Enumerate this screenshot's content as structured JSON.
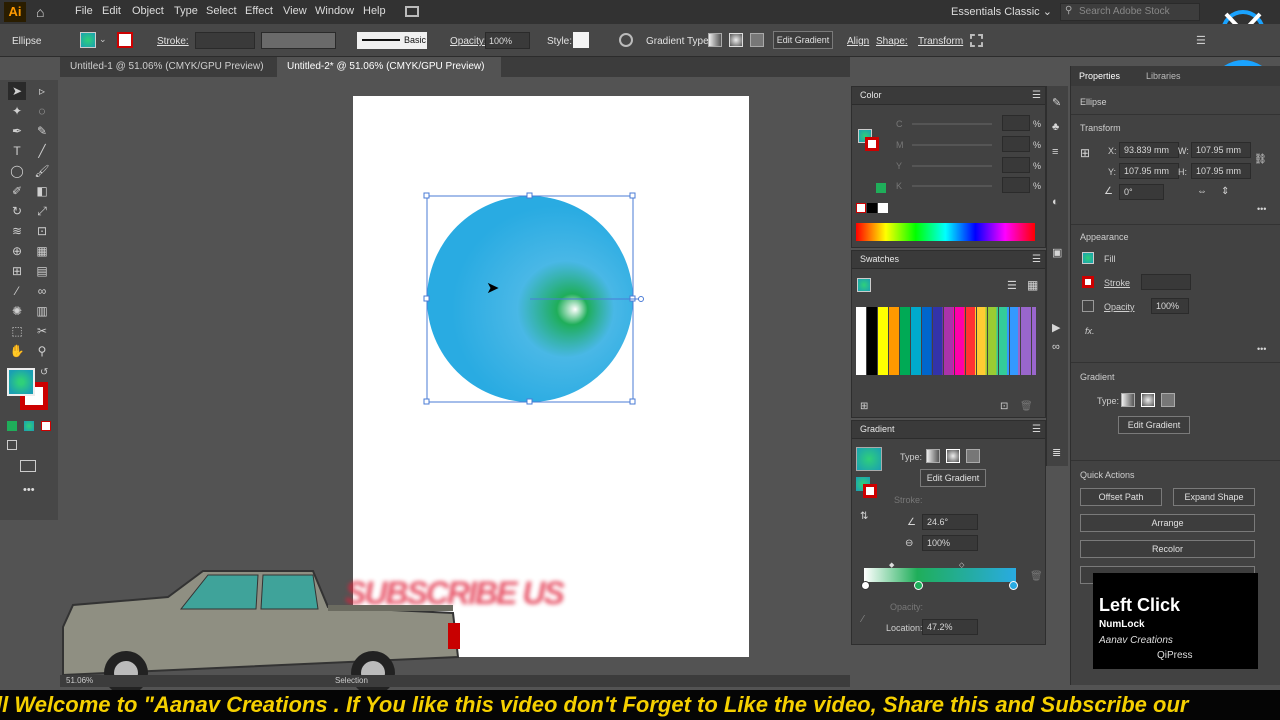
{
  "app": {
    "logo": "Ai",
    "workspace": "Essentials Classic",
    "search_placeholder": "Search Adobe Stock"
  },
  "menu": [
    "File",
    "Edit",
    "Object",
    "Type",
    "Select",
    "Effect",
    "View",
    "Window",
    "Help"
  ],
  "control": {
    "selection": "Ellipse",
    "stroke_label": "Stroke:",
    "brush": "Basic",
    "opacity_label": "Opacity:",
    "opacity": "100%",
    "style_label": "Style:",
    "gradient_type_label": "Gradient Type:",
    "edit_gradient": "Edit Gradient",
    "align": "Align",
    "shape": "Shape:",
    "transform": "Transform"
  },
  "tabs": [
    {
      "label": "Untitled-1 @ 51.06% (CMYK/GPU Preview)",
      "active": false
    },
    {
      "label": "Untitled-2* @ 51.06% (CMYK/GPU Preview)",
      "active": true
    }
  ],
  "status": {
    "zoom": "51.06%",
    "tool": "Selection"
  },
  "color_panel": {
    "title": "Color",
    "channels": [
      "C",
      "M",
      "Y",
      "K"
    ],
    "unit": "%"
  },
  "swatches_panel": {
    "title": "Swatches"
  },
  "gradient_panel": {
    "title": "Gradient",
    "type_label": "Type:",
    "edit_button": "Edit Gradient",
    "stroke_label": "Stroke:",
    "angle": "24.6°",
    "aspect": "100%",
    "opacity_label": "Opacity:",
    "location_label": "Location:",
    "location": "47.2%"
  },
  "properties": {
    "tabs": [
      "Properties",
      "Libraries"
    ],
    "object": "Ellipse",
    "transform_title": "Transform",
    "x_label": "X:",
    "x": "93.839 mm",
    "y_label": "Y:",
    "y": "107.95 mm",
    "w_label": "W:",
    "w": "107.95 mm",
    "h_label": "H:",
    "h": "107.95 mm",
    "angle": "0°",
    "appearance_title": "Appearance",
    "fill_label": "Fill",
    "stroke_label": "Stroke",
    "opacity_label": "Opacity",
    "opacity": "100%",
    "fx_label": "fx.",
    "gradient_title": "Gradient",
    "gradient_type_label": "Type:",
    "edit_gradient": "Edit Gradient",
    "quick_actions_title": "Quick Actions",
    "actions": [
      "Offset Path",
      "Expand Shape",
      "Arrange",
      "Recolor"
    ]
  },
  "overlay": {
    "key_title": "Left Click",
    "key_sub": "NumLock",
    "brand": "Aanav Creations",
    "qipress": "QiPress",
    "watermark": "SUBSCRIBE US",
    "banner": "ll Welcome to \"Aanav Creations . If You like this video don't Forget to Like the video, Share this and Subscribe our"
  },
  "colors": {
    "ellipse": "#29abe2",
    "gradient_green": "#1fae5a",
    "banner_text": "#f5d000"
  }
}
